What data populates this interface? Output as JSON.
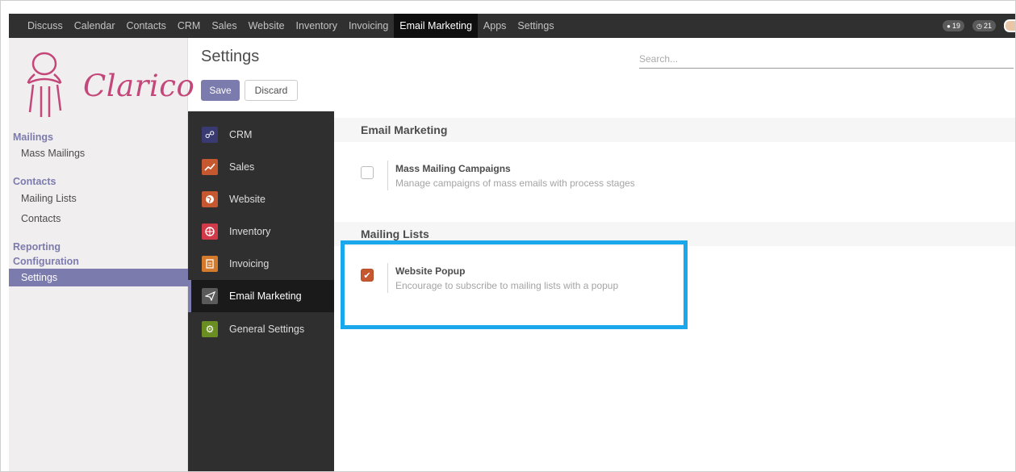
{
  "topbar": {
    "menu": [
      "Discuss",
      "Calendar",
      "Contacts",
      "CRM",
      "Sales",
      "Website",
      "Inventory",
      "Invoicing",
      "Email Marketing",
      "Apps",
      "Settings"
    ],
    "active_menu": "Email Marketing",
    "systray": {
      "messages_count": "19",
      "activities_count": "21"
    }
  },
  "logo": {
    "text": "Clarico"
  },
  "sidebar": {
    "mailings_heading": "Mailings",
    "mass_mailings": "Mass Mailings",
    "contacts_heading": "Contacts",
    "mailing_lists": "Mailing Lists",
    "contacts": "Contacts",
    "reporting_heading": "Reporting",
    "configuration_heading": "Configuration",
    "settings": "Settings"
  },
  "control_panel": {
    "title": "Settings",
    "save_label": "Save",
    "discard_label": "Discard",
    "search_placeholder": "Search..."
  },
  "apps": [
    {
      "label": "CRM",
      "icon": "handshake-icon",
      "color": "#3a3a72"
    },
    {
      "label": "Sales",
      "icon": "chart-line-icon",
      "color": "#c5582f"
    },
    {
      "label": "Website",
      "icon": "globe-icon",
      "color": "#c5582f"
    },
    {
      "label": "Inventory",
      "icon": "box-icon",
      "color": "#d23a4a"
    },
    {
      "label": "Invoicing",
      "icon": "invoice-icon",
      "color": "#d47a2d"
    },
    {
      "label": "Email Marketing",
      "icon": "paper-plane-icon",
      "color": "#5a5a5a"
    },
    {
      "label": "General Settings",
      "icon": "gear-icon",
      "color": "#6b8e23"
    }
  ],
  "sections": {
    "email_marketing": {
      "title": "Email Marketing",
      "setting_title": "Mass Mailing Campaigns",
      "setting_desc": "Manage campaigns of mass emails with process stages",
      "checked": false
    },
    "mailing_lists": {
      "title": "Mailing Lists",
      "setting_title": "Website Popup",
      "setting_desc": "Encourage to subscribe to mailing lists with a popup",
      "checked": true
    }
  },
  "colors": {
    "accent": "#7c7bad",
    "topbar": "#303030",
    "checkbox_checked": "#c5582f",
    "highlight": "#1aa7ec",
    "logo": "#c4477a"
  }
}
